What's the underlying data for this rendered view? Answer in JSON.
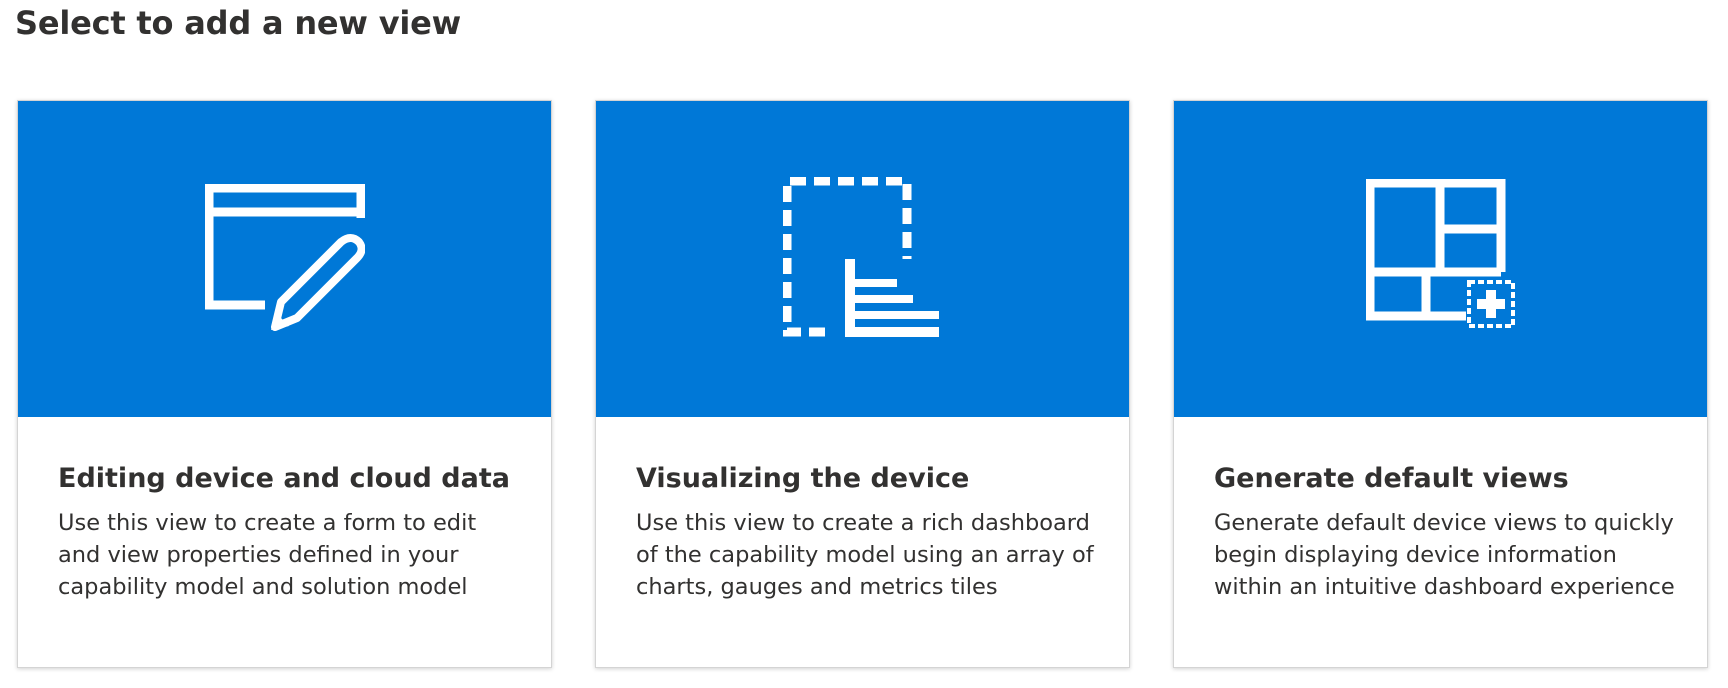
{
  "page": {
    "title": "Select to add a new view"
  },
  "colors": {
    "accent": "#0078D7",
    "icon": "#FFFFFF",
    "text": "#323130"
  },
  "cards": [
    {
      "icon": "form-edit-icon",
      "title": "Editing device and cloud data",
      "description": "Use this view to create a form to edit and view properties defined in your capability model and solution model"
    },
    {
      "icon": "visualization-dashboard-icon",
      "title": "Visualizing the device",
      "description": "Use this view to create a rich dashboard of the capability model using an array of charts, gauges and metrics tiles"
    },
    {
      "icon": "generate-views-icon",
      "title": "Generate default views",
      "description": "Generate default device views to quickly begin displaying device information within an intuitive dashboard experience"
    }
  ]
}
